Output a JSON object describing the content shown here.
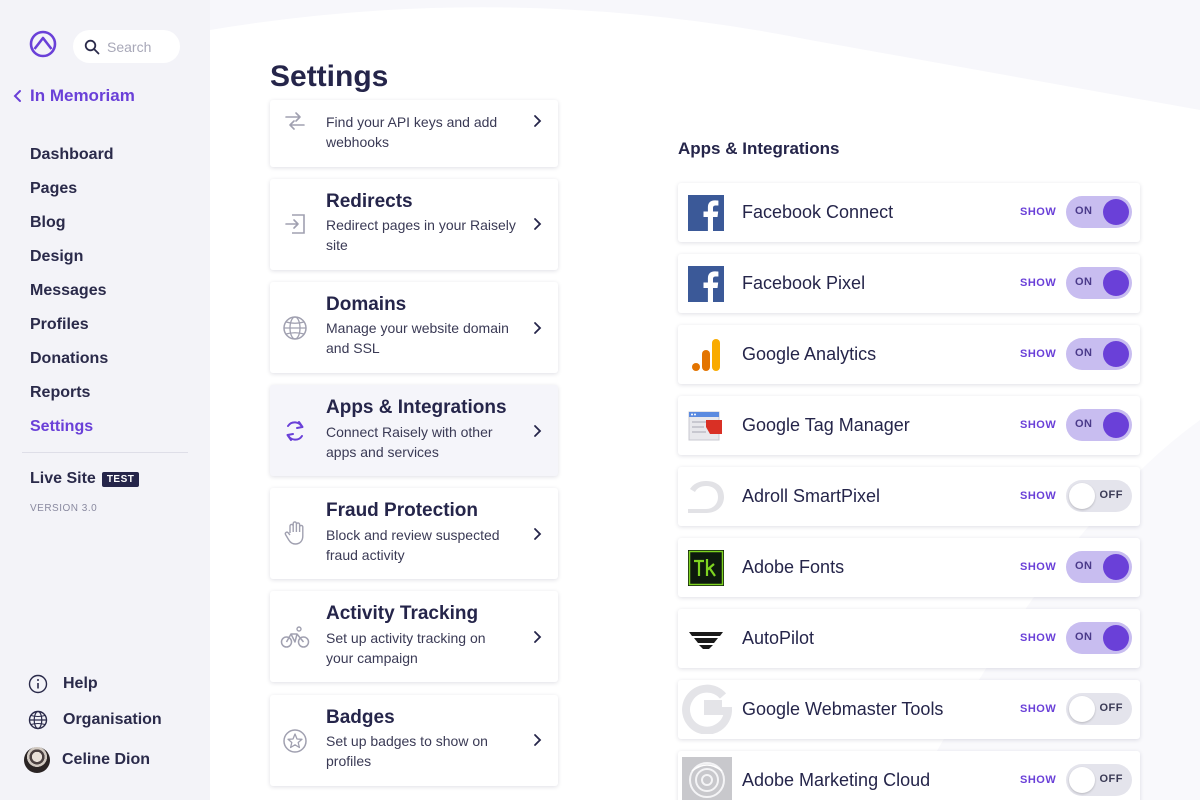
{
  "sidebar": {
    "search_placeholder": "Search",
    "back_label": "In Memoriam",
    "nav": [
      {
        "label": "Dashboard"
      },
      {
        "label": "Pages"
      },
      {
        "label": "Blog"
      },
      {
        "label": "Design"
      },
      {
        "label": "Messages"
      },
      {
        "label": "Profiles"
      },
      {
        "label": "Donations"
      },
      {
        "label": "Reports"
      },
      {
        "label": "Settings"
      }
    ],
    "active_item": "Settings",
    "live_site_label": "Live Site",
    "test_badge": "TEST",
    "version": "VERSION 3.0",
    "help_label": "Help",
    "organisation_label": "Organisation",
    "user_name": "Celine Dion"
  },
  "main": {
    "title": "Settings",
    "cards": [
      {
        "title": "",
        "desc": "Find your API keys and add webhooks",
        "icon": "arrows-swap-icon"
      },
      {
        "title": "Redirects",
        "desc": "Redirect pages in your Raisely site",
        "icon": "redirect-icon"
      },
      {
        "title": "Domains",
        "desc": "Manage your website domain and SSL",
        "icon": "globe-icon"
      },
      {
        "title": "Apps & Integrations",
        "desc": "Connect Raisely with other apps and services",
        "icon": "sync-icon"
      },
      {
        "title": "Fraud Protection",
        "desc": "Block and review suspected fraud activity",
        "icon": "hand-icon"
      },
      {
        "title": "Activity Tracking",
        "desc": "Set up activity tracking on your campaign",
        "icon": "bicycle-icon"
      },
      {
        "title": "Badges",
        "desc": "Set up badges to show on profiles",
        "icon": "star-badge-icon"
      }
    ],
    "highlighted_card": "Apps & Integrations"
  },
  "integrations": {
    "section_title": "Apps & Integrations",
    "show_label": "SHOW",
    "on_label": "ON",
    "off_label": "OFF",
    "apps": [
      {
        "name": "Facebook Connect",
        "enabled": true,
        "logo": "facebook-logo-icon"
      },
      {
        "name": "Facebook Pixel",
        "enabled": true,
        "logo": "facebook-logo-icon"
      },
      {
        "name": "Google Analytics",
        "enabled": true,
        "logo": "google-analytics-icon"
      },
      {
        "name": "Google Tag Manager",
        "enabled": true,
        "logo": "google-tag-manager-icon"
      },
      {
        "name": "Adroll SmartPixel",
        "enabled": false,
        "logo": "adroll-icon"
      },
      {
        "name": "Adobe Fonts",
        "enabled": true,
        "logo": "adobe-fonts-icon"
      },
      {
        "name": "AutoPilot",
        "enabled": true,
        "logo": "autopilot-icon"
      },
      {
        "name": "Google Webmaster Tools",
        "enabled": false,
        "logo": "google-webmaster-icon"
      },
      {
        "name": "Adobe Marketing Cloud",
        "enabled": false,
        "logo": "adobe-marketing-cloud-icon"
      }
    ]
  },
  "colors": {
    "accent": "#6a40d8",
    "toggle_on_bg": "#c8bdf0",
    "toggle_off_bg": "#e4e4ec",
    "sidebar_bg": "#f3f3f8",
    "text_dark": "#25254a"
  }
}
